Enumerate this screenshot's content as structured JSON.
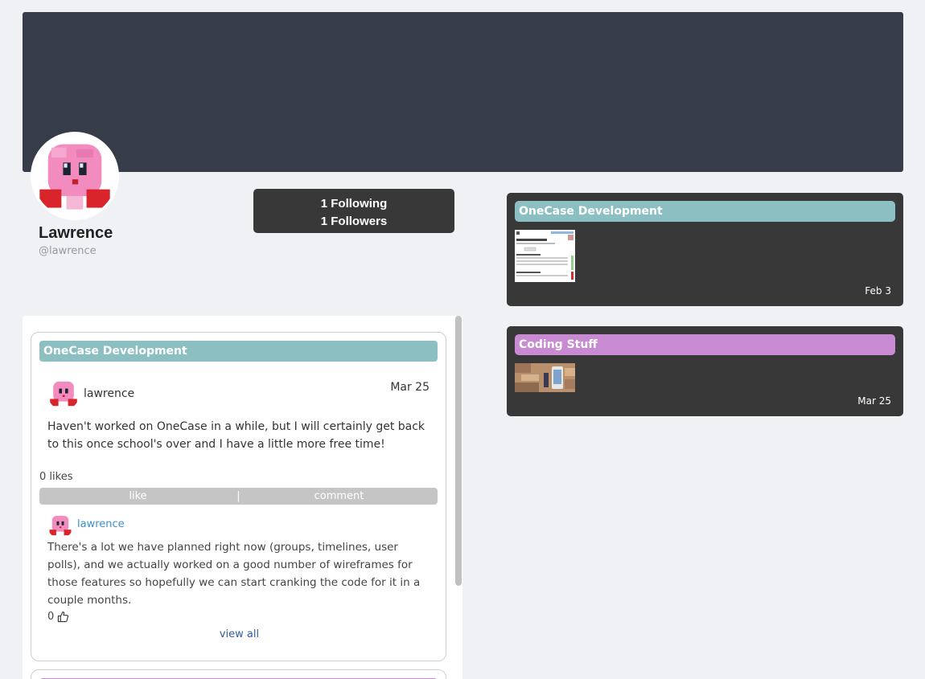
{
  "profile": {
    "name": "Lawrence",
    "handle": "@lawrence",
    "following": "1 Following",
    "followers": "1 Followers"
  },
  "groups": [
    {
      "title": "OneCase Development",
      "color": "#8cbfc1",
      "date": "Feb 3"
    },
    {
      "title": "Coding Stuff",
      "color": "#c88ad3",
      "date": "Mar 25"
    }
  ],
  "feed": {
    "post": {
      "group": "OneCase Development",
      "author": "lawrence",
      "date": "Mar 25",
      "body": "Haven't worked on OneCase in a while, but I will certainly get back to this once school's over and I have a little more free time!",
      "likes": "0 likes",
      "like_label": "like",
      "separator": "|",
      "comment_label": "comment",
      "comment": {
        "author": "lawrence",
        "body": "There's a lot we have planned right now (groups, timelines, user polls), and we actually worked on a good number of wireframes for those features so hopefully we can start cranking the code for it in a couple months.",
        "likes": "0"
      },
      "view_all": "view all"
    }
  },
  "colors": {
    "banner": "#373c49",
    "card": "#383838",
    "accent_link": "#3e8fcb"
  }
}
